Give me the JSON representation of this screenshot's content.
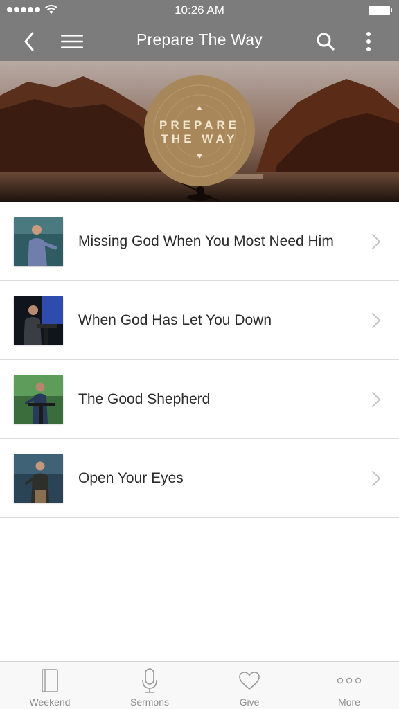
{
  "status_bar": {
    "time": "10:26 AM",
    "signal_icon": "signal-dots-icon",
    "wifi_icon": "wifi-icon",
    "battery_icon": "battery-icon"
  },
  "nav": {
    "title": "Prepare The Way",
    "back_icon": "chevron-left-icon",
    "menu_icon": "hamburger-menu-icon",
    "search_icon": "search-icon",
    "more_icon": "vertical-ellipsis-icon",
    "background": "#7c7c7c"
  },
  "banner": {
    "logo_line1": "PREPARE",
    "logo_line2": "THE WAY"
  },
  "sermons": [
    {
      "title": "Missing God When You Most Need Him",
      "thumb_icon": "speaker-thumbnail"
    },
    {
      "title": "When God Has Let You Down",
      "thumb_icon": "speaker-thumbnail"
    },
    {
      "title": "The Good Shepherd",
      "thumb_icon": "speaker-thumbnail"
    },
    {
      "title": "Open Your Eyes",
      "thumb_icon": "speaker-thumbnail"
    }
  ],
  "tabs": [
    {
      "label": "Weekend",
      "icon": "book-icon"
    },
    {
      "label": "Sermons",
      "icon": "microphone-icon"
    },
    {
      "label": "Give",
      "icon": "heart-icon"
    },
    {
      "label": "More",
      "icon": "horizontal-ellipsis-icon"
    }
  ],
  "colors": {
    "tab_inactive": "#8e8e8e",
    "divider": "#dcdcdc"
  }
}
